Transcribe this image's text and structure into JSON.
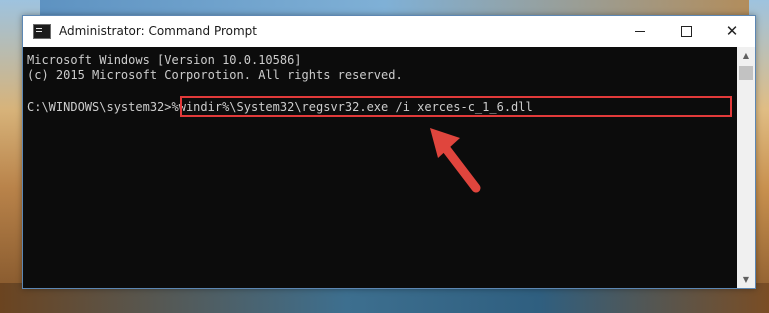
{
  "window": {
    "title": "Administrator: Command Prompt",
    "controls": {
      "minimize": "minimize",
      "maximize": "maximize",
      "close": "✕"
    }
  },
  "console": {
    "lines": [
      "Microsoft Windows [Version 10.0.10586]",
      "(c) 2015 Microsoft Corporotion. All rights reserved."
    ],
    "prompt": "C:\\WINDOWS\\system32>",
    "command": "%windir%\\System32\\regsvr32.exe /i xerces-c_1_6.dll"
  },
  "scrollbar": {
    "up_glyph": "▲",
    "down_glyph": "▼"
  },
  "colors": {
    "console_bg": "#0c0c0c",
    "console_text": "#cccccc",
    "highlight": "#e23a3a",
    "arrow": "#e0453d"
  },
  "icons": {
    "app": "cmd-icon",
    "arrow": "red-arrow-icon"
  }
}
